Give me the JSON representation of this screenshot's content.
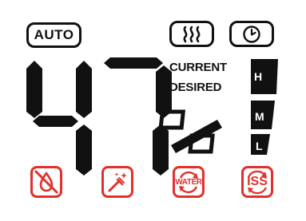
{
  "mode": {
    "auto_label": "AUTO"
  },
  "indicators": {
    "heat_icon": "heat-waves-icon",
    "timer_icon": "clock-icon"
  },
  "humidity": {
    "value": "47",
    "unit": "%",
    "current_label": "CURRENT",
    "desired_label": "DESIRED"
  },
  "fan_speed": {
    "high_label": "H",
    "medium_label": "M",
    "low_label": "L"
  },
  "status_icons": {
    "refill": "no-water-icon",
    "clean": "cleaning-brush-icon",
    "water_label": "WATER",
    "iss_label": "ISS"
  },
  "colors": {
    "segment": "#111111",
    "warning": "#e2302a",
    "background": "#ffffff"
  }
}
